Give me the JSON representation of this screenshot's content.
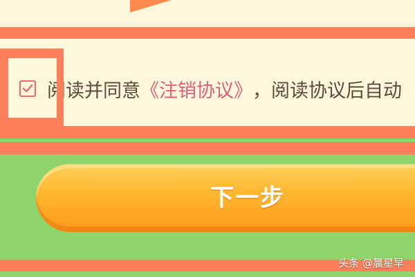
{
  "agreement": {
    "checked": true,
    "prefix": "阅读并同意",
    "link": "《注销协议》",
    "suffix": "，阅读协议后自动"
  },
  "next_button": {
    "label": "下一步"
  },
  "watermark": {
    "text": "头条 @晨星早"
  },
  "colors": {
    "highlight": "#ff7f5c",
    "button": "#ffb52e",
    "link": "#d9607a",
    "background_green": "#90d36a"
  },
  "icons": {
    "checkbox": "checkmark-icon"
  }
}
